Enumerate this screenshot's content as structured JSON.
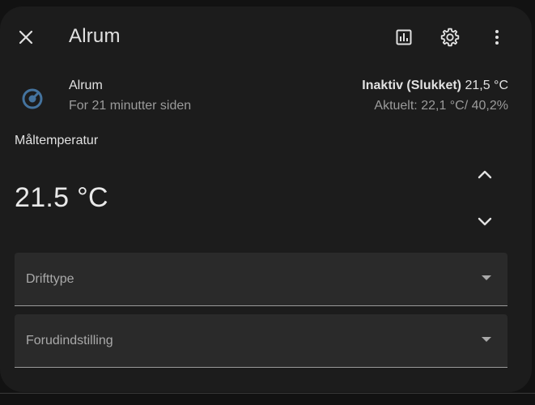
{
  "dialog": {
    "title": "Alrum",
    "header_icons": [
      "close-icon",
      "chart-icon",
      "gear-icon",
      "more-vertical-icon"
    ]
  },
  "entity": {
    "name": "Alrum",
    "last_changed": "For 21 minutter siden",
    "state_label": "Inaktiv (Slukket)",
    "state_setpoint": "21,5 °C",
    "current": "Aktuelt: 22,1 °C/ 40,2%",
    "icon": "thermostat-icon",
    "icon_color": "#44739e"
  },
  "target": {
    "label": "Måltemperatur",
    "value": "21.5 °C",
    "up_icon": "chevron-up-icon",
    "down_icon": "chevron-down-icon"
  },
  "selects": [
    {
      "label": "Drifttype",
      "value": ""
    },
    {
      "label": "Forudindstilling",
      "value": ""
    }
  ],
  "colors": {
    "dialog_background": "#1c1c1c",
    "text_primary": "#e1e1e1",
    "text_secondary": "#9b9b9b",
    "select_fill": "#2a2a2a"
  }
}
